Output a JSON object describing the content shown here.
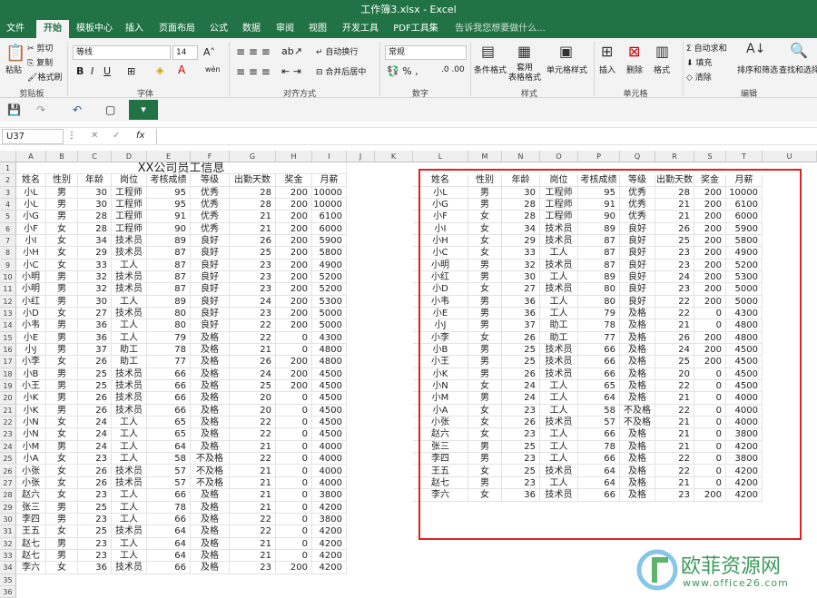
{
  "app": {
    "title": "工作簿3.xlsx - Excel"
  },
  "tabs": [
    "文件",
    "开始",
    "模板中心",
    "插入",
    "页面布局",
    "公式",
    "数据",
    "审阅",
    "视图",
    "开发工具",
    "PDF工具集",
    "告诉我您想要做什么..."
  ],
  "ribbon": {
    "clipboard": {
      "label": "剪贴板",
      "paste": "粘贴",
      "cut": "剪切",
      "copy": "复制",
      "format_painter": "格式刷"
    },
    "font": {
      "label": "字体",
      "name": "等线",
      "size": "14",
      "bold": "B",
      "italic": "I",
      "underline": "U",
      "wen": "wén"
    },
    "alignment": {
      "label": "对齐方式",
      "wrap": "自动换行",
      "merge": "合并后居中"
    },
    "number": {
      "label": "数字",
      "format": "常规"
    },
    "styles": {
      "label": "样式",
      "conditional": "条件格式",
      "table": "套用\n表格格式",
      "cell_styles": "单元格样式"
    },
    "cells": {
      "label": "单元格",
      "insert": "插入",
      "delete": "删除",
      "format": "格式"
    },
    "editing": {
      "label": "编辑",
      "autosum": "自动求和",
      "fill": "填充",
      "clear": "清除",
      "sort": "排序和筛选",
      "find": "查找和选择"
    }
  },
  "formula_bar": {
    "name_box": "U37",
    "fx": "fx",
    "value": ""
  },
  "columns": [
    "A",
    "B",
    "C",
    "D",
    "E",
    "F",
    "G",
    "H",
    "I",
    "J",
    "K",
    "L",
    "M",
    "N",
    "O",
    "P",
    "Q",
    "R",
    "S",
    "T",
    "U"
  ],
  "left_title": "XX公司员工信息",
  "headers": [
    "姓名",
    "性别",
    "年龄",
    "岗位",
    "考核成绩",
    "等级",
    "出勤天数",
    "奖金",
    "月薪"
  ],
  "left_rows": [
    [
      "小L",
      "男",
      "30",
      "工程师",
      "95",
      "优秀",
      "28",
      "200",
      "10000"
    ],
    [
      "小L",
      "男",
      "30",
      "工程师",
      "95",
      "优秀",
      "28",
      "200",
      "10000"
    ],
    [
      "小G",
      "男",
      "28",
      "工程师",
      "91",
      "优秀",
      "21",
      "200",
      "6100"
    ],
    [
      "小F",
      "女",
      "28",
      "工程师",
      "90",
      "优秀",
      "21",
      "200",
      "6000"
    ],
    [
      "小I",
      "女",
      "34",
      "技术员",
      "89",
      "良好",
      "26",
      "200",
      "5900"
    ],
    [
      "小H",
      "女",
      "29",
      "技术员",
      "87",
      "良好",
      "25",
      "200",
      "5800"
    ],
    [
      "小C",
      "女",
      "33",
      "工人",
      "87",
      "良好",
      "23",
      "200",
      "4900"
    ],
    [
      "小明",
      "男",
      "32",
      "技术员",
      "87",
      "良好",
      "23",
      "200",
      "5200"
    ],
    [
      "小明",
      "男",
      "32",
      "技术员",
      "87",
      "良好",
      "23",
      "200",
      "5200"
    ],
    [
      "小红",
      "男",
      "30",
      "工人",
      "89",
      "良好",
      "24",
      "200",
      "5300"
    ],
    [
      "小D",
      "女",
      "27",
      "技术员",
      "80",
      "良好",
      "23",
      "200",
      "5000"
    ],
    [
      "小韦",
      "男",
      "36",
      "工人",
      "80",
      "良好",
      "22",
      "200",
      "5000"
    ],
    [
      "小E",
      "男",
      "36",
      "工人",
      "79",
      "及格",
      "22",
      "0",
      "4300"
    ],
    [
      "小J",
      "男",
      "37",
      "助工",
      "78",
      "及格",
      "21",
      "0",
      "4800"
    ],
    [
      "小李",
      "女",
      "26",
      "助工",
      "77",
      "及格",
      "26",
      "200",
      "4800"
    ],
    [
      "小B",
      "男",
      "25",
      "技术员",
      "66",
      "及格",
      "24",
      "200",
      "4500"
    ],
    [
      "小王",
      "男",
      "25",
      "技术员",
      "66",
      "及格",
      "25",
      "200",
      "4500"
    ],
    [
      "小K",
      "男",
      "26",
      "技术员",
      "66",
      "及格",
      "20",
      "0",
      "4500"
    ],
    [
      "小K",
      "男",
      "26",
      "技术员",
      "66",
      "及格",
      "20",
      "0",
      "4500"
    ],
    [
      "小N",
      "女",
      "24",
      "工人",
      "65",
      "及格",
      "22",
      "0",
      "4500"
    ],
    [
      "小N",
      "女",
      "24",
      "工人",
      "65",
      "及格",
      "22",
      "0",
      "4500"
    ],
    [
      "小M",
      "男",
      "24",
      "工人",
      "64",
      "及格",
      "21",
      "0",
      "4000"
    ],
    [
      "小A",
      "女",
      "23",
      "工人",
      "58",
      "不及格",
      "22",
      "0",
      "4000"
    ],
    [
      "小张",
      "女",
      "26",
      "技术员",
      "57",
      "不及格",
      "21",
      "0",
      "4000"
    ],
    [
      "小张",
      "女",
      "26",
      "技术员",
      "57",
      "不及格",
      "21",
      "0",
      "4000"
    ],
    [
      "赵六",
      "女",
      "23",
      "工人",
      "66",
      "及格",
      "21",
      "0",
      "3800"
    ],
    [
      "张三",
      "男",
      "25",
      "工人",
      "78",
      "及格",
      "21",
      "0",
      "4200"
    ],
    [
      "李四",
      "男",
      "23",
      "工人",
      "66",
      "及格",
      "22",
      "0",
      "3800"
    ],
    [
      "王五",
      "女",
      "25",
      "技术员",
      "64",
      "及格",
      "22",
      "0",
      "4200"
    ],
    [
      "赵七",
      "男",
      "23",
      "工人",
      "64",
      "及格",
      "21",
      "0",
      "4200"
    ],
    [
      "赵七",
      "男",
      "23",
      "工人",
      "64",
      "及格",
      "21",
      "0",
      "4200"
    ],
    [
      "李六",
      "女",
      "36",
      "技术员",
      "66",
      "及格",
      "23",
      "200",
      "4200"
    ]
  ],
  "right_rows": [
    [
      "小L",
      "男",
      "30",
      "工程师",
      "95",
      "优秀",
      "28",
      "200",
      "10000"
    ],
    [
      "小G",
      "男",
      "28",
      "工程师",
      "91",
      "优秀",
      "21",
      "200",
      "6100"
    ],
    [
      "小F",
      "女",
      "28",
      "工程师",
      "90",
      "优秀",
      "21",
      "200",
      "6000"
    ],
    [
      "小I",
      "女",
      "34",
      "技术员",
      "89",
      "良好",
      "26",
      "200",
      "5900"
    ],
    [
      "小H",
      "女",
      "29",
      "技术员",
      "87",
      "良好",
      "25",
      "200",
      "5800"
    ],
    [
      "小C",
      "女",
      "33",
      "工人",
      "87",
      "良好",
      "23",
      "200",
      "4900"
    ],
    [
      "小明",
      "男",
      "32",
      "技术员",
      "87",
      "良好",
      "23",
      "200",
      "5200"
    ],
    [
      "小红",
      "男",
      "30",
      "工人",
      "89",
      "良好",
      "24",
      "200",
      "5300"
    ],
    [
      "小D",
      "女",
      "27",
      "技术员",
      "80",
      "良好",
      "23",
      "200",
      "5000"
    ],
    [
      "小韦",
      "男",
      "36",
      "工人",
      "80",
      "良好",
      "22",
      "200",
      "5000"
    ],
    [
      "小E",
      "男",
      "36",
      "工人",
      "79",
      "及格",
      "22",
      "0",
      "4300"
    ],
    [
      "小J",
      "男",
      "37",
      "助工",
      "78",
      "及格",
      "21",
      "0",
      "4800"
    ],
    [
      "小李",
      "女",
      "26",
      "助工",
      "77",
      "及格",
      "26",
      "200",
      "4800"
    ],
    [
      "小B",
      "男",
      "25",
      "技术员",
      "66",
      "及格",
      "24",
      "200",
      "4500"
    ],
    [
      "小王",
      "男",
      "25",
      "技术员",
      "66",
      "及格",
      "25",
      "200",
      "4500"
    ],
    [
      "小K",
      "男",
      "26",
      "技术员",
      "66",
      "及格",
      "20",
      "0",
      "4500"
    ],
    [
      "小N",
      "女",
      "24",
      "工人",
      "65",
      "及格",
      "22",
      "0",
      "4500"
    ],
    [
      "小M",
      "男",
      "24",
      "工人",
      "64",
      "及格",
      "21",
      "0",
      "4000"
    ],
    [
      "小A",
      "女",
      "23",
      "工人",
      "58",
      "不及格",
      "22",
      "0",
      "4000"
    ],
    [
      "小张",
      "女",
      "26",
      "技术员",
      "57",
      "不及格",
      "21",
      "0",
      "4000"
    ],
    [
      "赵六",
      "女",
      "23",
      "工人",
      "66",
      "及格",
      "21",
      "0",
      "3800"
    ],
    [
      "张三",
      "男",
      "25",
      "工人",
      "78",
      "及格",
      "21",
      "0",
      "4200"
    ],
    [
      "李四",
      "男",
      "23",
      "工人",
      "66",
      "及格",
      "22",
      "0",
      "3800"
    ],
    [
      "王五",
      "女",
      "25",
      "技术员",
      "64",
      "及格",
      "22",
      "0",
      "4200"
    ],
    [
      "赵七",
      "男",
      "23",
      "工人",
      "64",
      "及格",
      "21",
      "0",
      "4200"
    ],
    [
      "李六",
      "女",
      "36",
      "技术员",
      "66",
      "及格",
      "23",
      "200",
      "4200"
    ]
  ],
  "watermark": {
    "brand": "欧菲资源网",
    "url": "www.office26.com"
  }
}
